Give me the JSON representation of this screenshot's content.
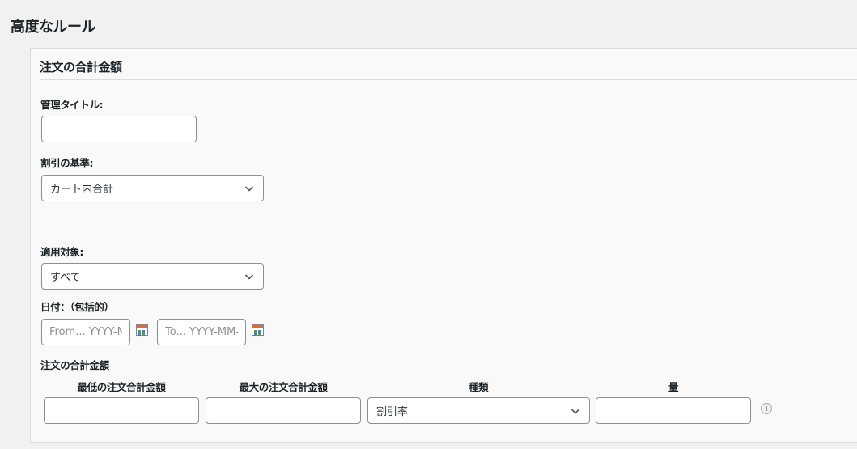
{
  "page": {
    "title": "高度なルール"
  },
  "panel": {
    "header": "注文の合計金額"
  },
  "admin_title": {
    "label": "管理タイトル:",
    "value": "",
    "placeholder": ""
  },
  "discount_basis": {
    "label": "割引の基準:",
    "selected": "カート内合計"
  },
  "applies_to": {
    "label": "適用対象:",
    "selected": "すべて"
  },
  "date": {
    "label": "日付：（包括的）",
    "from_placeholder": "From... YYYY-MM-DD",
    "to_placeholder": "To... YYYY-MM-DD"
  },
  "order_total": {
    "label": "注文の合計金額",
    "columns": [
      "最低の注文合計金額",
      "最大の注文合計金額",
      "種類",
      "量"
    ],
    "row": {
      "min": "",
      "max": "",
      "type": "割引率",
      "amount": ""
    }
  }
}
